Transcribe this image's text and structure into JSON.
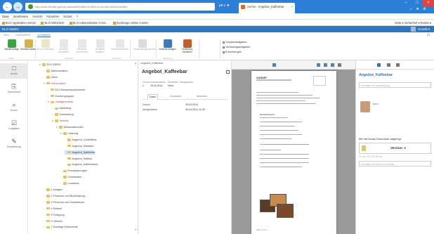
{
  "browser": {
    "url": "http://eloit-fill.web-ged.de.portal/#/3b9db1c4-d3b1-4c3c-9dd-4d322e3d9b1",
    "tab_title": "Archiv - Angebot_Kaffeebar",
    "tab_close": "×",
    "back": "←",
    "forward": "→",
    "addr_tools": "ρ▾ c ★",
    "win_min": "–",
    "win_max": "□",
    "win_close": "×",
    "top_right": "⌂ ★ ⚙"
  },
  "menu": [
    "Datei",
    "Bearbeiten",
    "Ansicht",
    "Favoriten",
    "Extras",
    "?"
  ],
  "favorites": [
    "ELO Application Server",
    "ELO Webclient",
    "ELO Administration Cons...",
    "Exchange Admin Center"
  ],
  "fav_tools": "Seite ▾  Sicherheit ▾  Extras ▾",
  "app": {
    "title": "ELO DEMO",
    "user": "Donalit ▾"
  },
  "ribbon": {
    "tabs": [
      "NEU",
      "DOKUMENT",
      "AUSWAHL"
    ],
    "buttons": [
      {
        "label": "Wiedervorlage",
        "color": "#3aa53a",
        "dim": false
      },
      {
        "label": "Workflow starten",
        "color": "#d4b24e",
        "dim": false
      },
      {
        "label": "Ad-hoc Workflow",
        "color": "#c9b36a",
        "dim": true
      },
      {
        "label": "Workflow weiterleiten",
        "color": "#b7b7b7",
        "dim": true
      },
      {
        "label": "Workflow übernehmen",
        "color": "#b7b7b7",
        "dim": true
      },
      {
        "label": "Workflow abgeben",
        "color": "#b7b7b7",
        "dim": true
      },
      {
        "label": "Workflowabbruch",
        "color": "#b7b7b7",
        "dim": true
      },
      {
        "label": "Verwendungsnachweis",
        "color": "#999999",
        "dim": true
      },
      {
        "label": "Verlinkte Ablagen",
        "color": "#3a7cc0",
        "dim": false
      },
      {
        "label": "Verlinkung herstellen",
        "color": "#c65a2a",
        "dim": false
      }
    ],
    "groups": [
      "Aktion",
      "Workflow",
      "Übersicht",
      "Verlinkung"
    ],
    "checks": [
      "Gruppenaufgaben",
      "Vertretungsaufgaben",
      "Erinnerungen"
    ]
  },
  "sidebar": [
    {
      "label": "Archiv",
      "icon": "□"
    },
    {
      "label": "Klemmbrett",
      "icon": "⎘"
    },
    {
      "label": "Suche",
      "icon": "⌕"
    },
    {
      "label": "Aufgaben",
      "icon": "☑"
    },
    {
      "label": "Bearbeitung",
      "icon": "✎"
    }
  ],
  "tree": [
    {
      "label": "ELO DEMO",
      "level": 0,
      "tog": "▾",
      "red": false,
      "sel": false
    },
    {
      "label": "Administration",
      "level": 1,
      "tog": "›",
      "red": false,
      "sel": false
    },
    {
      "label": "Intern",
      "level": 1,
      "tog": "›",
      "red": false,
      "sel": false
    },
    {
      "label": "Demoordner",
      "level": 1,
      "tog": "▾",
      "red": true,
      "sel": false
    },
    {
      "label": "ELO Beispielsdokumente",
      "level": 2,
      "tog": "›",
      "red": false,
      "sel": false
    },
    {
      "label": "Kundengruppen",
      "level": 2,
      "tog": "›",
      "red": false,
      "sel": false
    },
    {
      "label": "Vorlagenordner",
      "level": 2,
      "tog": "▾",
      "red": true,
      "sel": false
    },
    {
      "label": "Marketing",
      "level": 3,
      "tog": "›",
      "red": false,
      "sel": false
    },
    {
      "label": "Entwicklung",
      "level": 3,
      "tog": "›",
      "red": false,
      "sel": false
    },
    {
      "label": "Vertrieb",
      "level": 3,
      "tog": "▾",
      "red": true,
      "sel": false
    },
    {
      "label": "Bestandskunden",
      "level": 4,
      "tog": "▾",
      "red": false,
      "sel": false
    },
    {
      "label": "Catering",
      "level": 5,
      "tog": "▾",
      "red": false,
      "sel": false
    },
    {
      "label": "Angebot_Cocktailbar",
      "level": 6,
      "tog": "",
      "red": false,
      "sel": false
    },
    {
      "label": "Angebot_Eisstand",
      "level": 6,
      "tog": "",
      "red": false,
      "sel": false
    },
    {
      "label": "Angebot_Kaffeebar",
      "level": 6,
      "tog": "",
      "red": false,
      "sel": true
    },
    {
      "label": "Angebot_Saftbar",
      "level": 6,
      "tog": "",
      "red": false,
      "sel": false
    },
    {
      "label": "Angebot_Kaffeestand",
      "level": 6,
      "tog": "",
      "red": false,
      "sel": false
    },
    {
      "label": "Eventplanungen",
      "level": 5,
      "tog": "›",
      "red": false,
      "sel": false
    },
    {
      "label": "Checklisten",
      "level": 5,
      "tog": "›",
      "red": false,
      "sel": false
    },
    {
      "label": "Locations",
      "level": 5,
      "tog": "›",
      "red": false,
      "sel": false
    },
    {
      "label": "1 Anlagen",
      "level": 1,
      "tog": "›",
      "red": false,
      "sel": false
    },
    {
      "label": "2 Finanzen und Buchhaltung",
      "level": 1,
      "tog": "›",
      "red": false,
      "sel": false
    },
    {
      "label": "3 Personal und Sozialwesen",
      "level": 1,
      "tog": "›",
      "red": false,
      "sel": false
    },
    {
      "label": "4 Einkauf",
      "level": 1,
      "tog": "›",
      "red": false,
      "sel": false
    },
    {
      "label": "5 Fertigung",
      "level": 1,
      "tog": "›",
      "red": false,
      "sel": false
    },
    {
      "label": "6 Vertrieb",
      "level": 1,
      "tog": "›",
      "red": false,
      "sel": false
    },
    {
      "label": "7 Sonstige Dokumente",
      "level": 1,
      "tog": "›",
      "red": false,
      "sel": false
    }
  ],
  "tree_up": "▴",
  "tree_down": "▾",
  "center": {
    "breadcrumb": "Angebot_Kaffeebar",
    "title": "Angebot_Kaffeebar",
    "meta_heads": [
      "Version",
      "Versionsdatum",
      "Bearbeiter",
      "Ablagedatum"
    ],
    "meta_vals": [
      "1",
      "26.04.2014",
      "Hess",
      ""
    ],
    "tabs": [
      "Daten",
      "Zusatztext",
      "Ablennen"
    ],
    "fields": [
      {
        "label": "Datum",
        "value": "30.04.2014"
      },
      {
        "label": "Ablagedatum",
        "value": "30.04.2014 11:30"
      }
    ]
  },
  "preview": {
    "logo": "VIASNET",
    "section": "Bestellübersicht",
    "footer": "Seite 1 von 1"
  },
  "right": {
    "title": "Angebot_Kaffeebar",
    "note_hint": "Schreiben Sie einen Beitrag",
    "avatar_name": "EMILY",
    "notify": "Bill hat neues Dokument abgelegt.",
    "version_label": "Version: 1",
    "version_date": "30. Apr. 2014 11:30 Uhr",
    "comment_hint": "Schreiben Sie einen Kommentar"
  }
}
